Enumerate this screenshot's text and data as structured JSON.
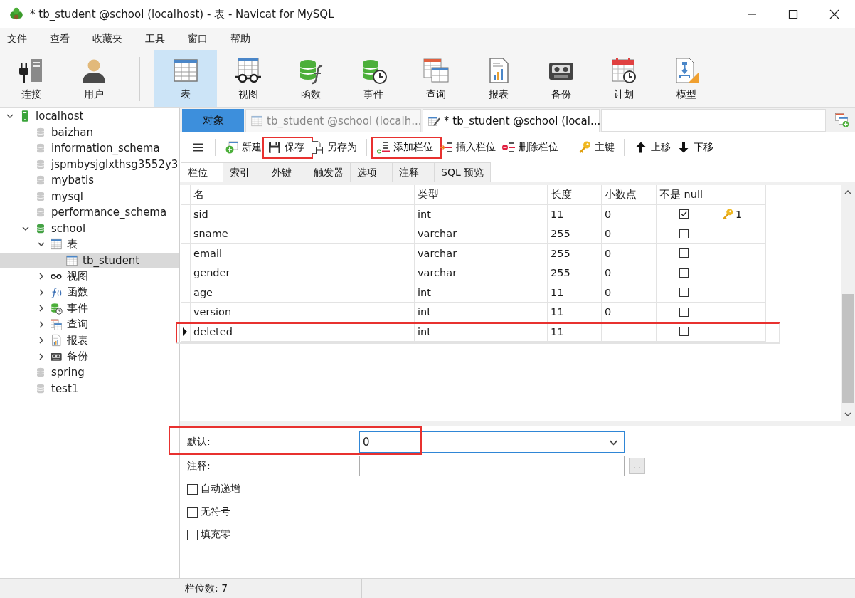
{
  "window": {
    "title": "* tb_student @school (localhost) - 表 - Navicat for MySQL"
  },
  "menu": [
    "文件",
    "查看",
    "收藏夹",
    "工具",
    "窗口",
    "帮助"
  ],
  "toolbar": [
    {
      "label": "连接",
      "kind": "connect",
      "selected": false,
      "separator_before": false
    },
    {
      "label": "用户",
      "kind": "user",
      "selected": false,
      "separator_before": false
    },
    {
      "label": "表",
      "kind": "table",
      "selected": true,
      "separator_before": true
    },
    {
      "label": "视图",
      "kind": "view",
      "selected": false,
      "separator_before": false
    },
    {
      "label": "函数",
      "kind": "function",
      "selected": false,
      "separator_before": false
    },
    {
      "label": "事件",
      "kind": "event",
      "selected": false,
      "separator_before": false
    },
    {
      "label": "查询",
      "kind": "query",
      "selected": false,
      "separator_before": false
    },
    {
      "label": "报表",
      "kind": "report",
      "selected": false,
      "separator_before": false
    },
    {
      "label": "备份",
      "kind": "backup",
      "selected": false,
      "separator_before": false
    },
    {
      "label": "计划",
      "kind": "schedule",
      "selected": false,
      "separator_before": false
    },
    {
      "label": "模型",
      "kind": "model",
      "selected": false,
      "separator_before": false
    }
  ],
  "sidebar": {
    "tree": [
      {
        "label": "localhost",
        "kind": "server",
        "expanded": true,
        "selected": false,
        "children": [
          {
            "label": "baizhan",
            "kind": "database",
            "selected": false
          },
          {
            "label": "information_schema",
            "kind": "database",
            "selected": false
          },
          {
            "label": "jspmbysjglxthsg3552y3",
            "kind": "database",
            "selected": false
          },
          {
            "label": "mybatis",
            "kind": "database",
            "selected": false
          },
          {
            "label": "mysql",
            "kind": "database",
            "selected": false
          },
          {
            "label": "performance_schema",
            "kind": "database",
            "selected": false
          },
          {
            "label": "school",
            "kind": "database-open",
            "expanded": true,
            "selected": false,
            "children": [
              {
                "label": "表",
                "kind": "table",
                "expanded": true,
                "selected": false,
                "children": [
                  {
                    "label": "tb_student",
                    "kind": "table",
                    "selected": true
                  }
                ]
              },
              {
                "label": "视图",
                "kind": "views",
                "expanded": false,
                "selected": false
              },
              {
                "label": "函数",
                "kind": "functions",
                "expanded": false,
                "selected": false
              },
              {
                "label": "事件",
                "kind": "event",
                "expanded": false,
                "selected": false
              },
              {
                "label": "查询",
                "kind": "query",
                "expanded": false,
                "selected": false
              },
              {
                "label": "报表",
                "kind": "report",
                "expanded": false,
                "selected": false
              },
              {
                "label": "备份",
                "kind": "backup",
                "expanded": false,
                "selected": false
              }
            ]
          },
          {
            "label": "spring",
            "kind": "database",
            "selected": false
          },
          {
            "label": "test1",
            "kind": "database",
            "selected": false
          }
        ]
      }
    ]
  },
  "tabs": [
    {
      "label": "对象",
      "kind": "objects",
      "selected": false
    },
    {
      "label": "tb_student @school (localh...",
      "kind": "table",
      "selected": false
    },
    {
      "label": "* tb_student @school (local...",
      "kind": "design",
      "selected": true
    }
  ],
  "editor_toolbar": [
    {
      "kind": "menu",
      "separator_before": false,
      "highlighted": false
    },
    {
      "label": "新建",
      "kind": "new",
      "separator_before": true,
      "highlighted": false
    },
    {
      "label": "保存",
      "kind": "save",
      "separator_before": false,
      "highlighted": true
    },
    {
      "label": "另存为",
      "kind": "save-as",
      "separator_before": false,
      "highlighted": false
    },
    {
      "label": "添加栏位",
      "kind": "add-field",
      "separator_before": true,
      "highlighted": true
    },
    {
      "label": "插入栏位",
      "kind": "insert-field",
      "separator_before": false,
      "highlighted": false
    },
    {
      "label": "删除栏位",
      "kind": "delete-field",
      "separator_before": false,
      "highlighted": false
    },
    {
      "label": "主键",
      "kind": "primary-key",
      "separator_before": true,
      "highlighted": false
    },
    {
      "label": "上移",
      "kind": "move-up",
      "separator_before": true,
      "highlighted": false
    },
    {
      "label": "下移",
      "kind": "move-down",
      "separator_before": false,
      "highlighted": false
    }
  ],
  "field_tabs": [
    {
      "label": "栏位",
      "selected": true
    },
    {
      "label": "索引",
      "selected": false
    },
    {
      "label": "外键",
      "selected": false
    },
    {
      "label": "触发器",
      "selected": false
    },
    {
      "label": "选项",
      "selected": false
    },
    {
      "label": "注释",
      "selected": false
    },
    {
      "label": "SQL 预览",
      "selected": false
    }
  ],
  "table": {
    "columns": [
      "名",
      "类型",
      "长度",
      "小数点",
      "不是 null"
    ],
    "rows": [
      {
        "name": "sid",
        "type": "int",
        "length": "11",
        "decimals": "0",
        "not_null": true,
        "key": "1",
        "selected": false,
        "highlighted": false
      },
      {
        "name": "sname",
        "type": "varchar",
        "length": "255",
        "decimals": "0",
        "not_null": false,
        "selected": false,
        "highlighted": false
      },
      {
        "name": "email",
        "type": "varchar",
        "length": "255",
        "decimals": "0",
        "not_null": false,
        "selected": false,
        "highlighted": false
      },
      {
        "name": "gender",
        "type": "varchar",
        "length": "255",
        "decimals": "0",
        "not_null": false,
        "selected": false,
        "highlighted": false
      },
      {
        "name": "age",
        "type": "int",
        "length": "11",
        "decimals": "0",
        "not_null": false,
        "selected": false,
        "highlighted": false
      },
      {
        "name": "version",
        "type": "int",
        "length": "11",
        "decimals": "0",
        "not_null": false,
        "selected": false,
        "highlighted": false
      },
      {
        "name": "deleted",
        "type": "int",
        "length": "11",
        "not_null": false,
        "selected": true,
        "highlighted": true
      }
    ]
  },
  "properties": {
    "default": {
      "label": "默认:",
      "value": "0",
      "focused": true,
      "highlighted": true
    },
    "comment": {
      "label": "注释:",
      "button": "...",
      "focused": false
    },
    "options": [
      {
        "label": "自动递增",
        "checked": false
      },
      {
        "label": "无符号",
        "checked": false
      },
      {
        "label": "填充零",
        "checked": false
      }
    ]
  },
  "status_bar": {
    "text": "栏位数: 7"
  }
}
